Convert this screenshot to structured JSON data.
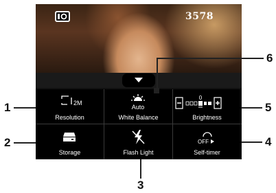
{
  "preview": {
    "shot_count": "3578",
    "mode_icon": "camera-mode-icon"
  },
  "panel": {
    "collapse_icon": "chevron-down-icon",
    "items": [
      {
        "label": "Resolution",
        "value": "2M",
        "icon": "resolution-icon"
      },
      {
        "label": "White Balance",
        "value": "Auto",
        "icon": "white-balance-icon"
      },
      {
        "label": "Brightness",
        "value": "0",
        "icon": "brightness-icon"
      },
      {
        "label": "Storage",
        "icon": "storage-icon"
      },
      {
        "label": "Flash Light",
        "icon": "flash-off-icon"
      },
      {
        "label": "Self-timer",
        "value": "OFF",
        "icon": "self-timer-icon"
      }
    ]
  },
  "callouts": [
    "1",
    "2",
    "3",
    "4",
    "5",
    "6"
  ]
}
